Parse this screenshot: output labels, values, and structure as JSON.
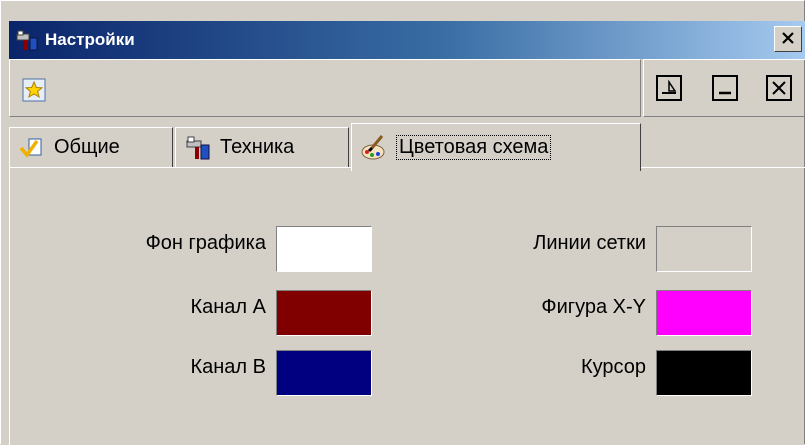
{
  "window": {
    "title": "Настройки",
    "close_glyph": "x"
  },
  "toolbar": {
    "icon": "star-document-icon"
  },
  "tabs": [
    {
      "label": "Общие",
      "icon": "checkmark-pencil-icon",
      "active": false
    },
    {
      "label": "Техника",
      "icon": "hardware-icon",
      "active": false
    },
    {
      "label": "Цветовая схема",
      "icon": "palette-brush-icon",
      "active": true
    }
  ],
  "colors": {
    "left": [
      {
        "label": "Фон графика",
        "color": "#ffffff"
      },
      {
        "label": "Канал А",
        "color": "#800000"
      },
      {
        "label": "Канал В",
        "color": "#000080"
      }
    ],
    "right": [
      {
        "label": "Линии сетки",
        "color": "#d4d0c8"
      },
      {
        "label": "Фигура X-Y",
        "color": "#ff00ff"
      },
      {
        "label": "Курсор",
        "color": "#000000"
      }
    ]
  }
}
